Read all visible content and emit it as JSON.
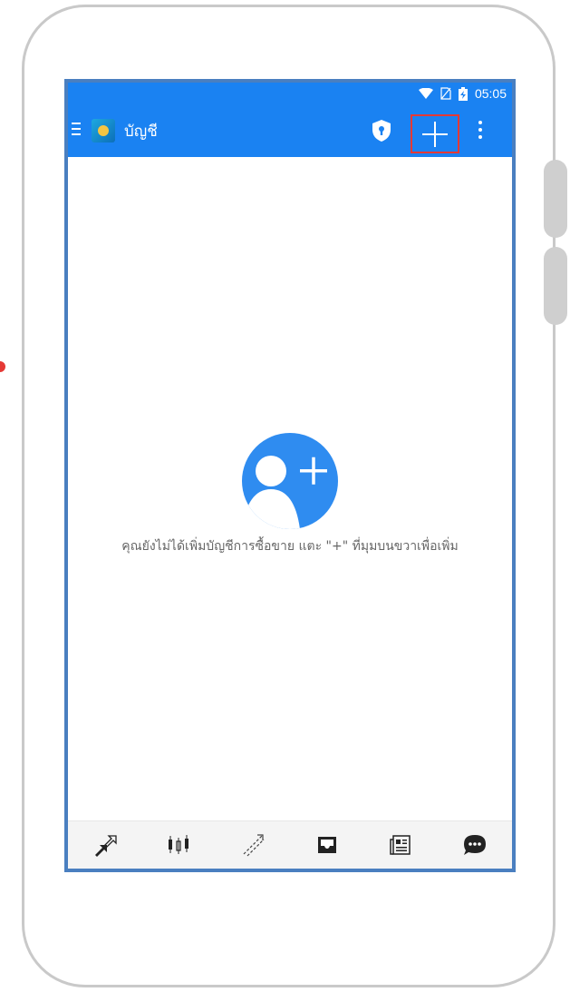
{
  "status_bar": {
    "time": "05:05",
    "icons": [
      "wifi-icon",
      "no-sim-icon",
      "battery-charging-icon"
    ]
  },
  "app_bar": {
    "title": "บัญชี",
    "icons": [
      "menu-icon",
      "app-logo",
      "shield-icon",
      "add-icon",
      "more-vert-icon"
    ]
  },
  "empty_state": {
    "icon": "add-person-icon",
    "message": "คุณยังไม่ได้เพิ่มบัญชีการซื้อขาย แตะ \"+\" ที่มุมบนขวาเพื่อเพิ่ม"
  },
  "bottom_nav": {
    "items": [
      "quotes-icon",
      "chart-candles-icon",
      "trade-icon",
      "history-inbox-icon",
      "news-icon",
      "chat-icon"
    ]
  },
  "colors": {
    "accent": "#1a82f2",
    "highlight": "#e53935",
    "screen_border": "#4a7fc0"
  }
}
